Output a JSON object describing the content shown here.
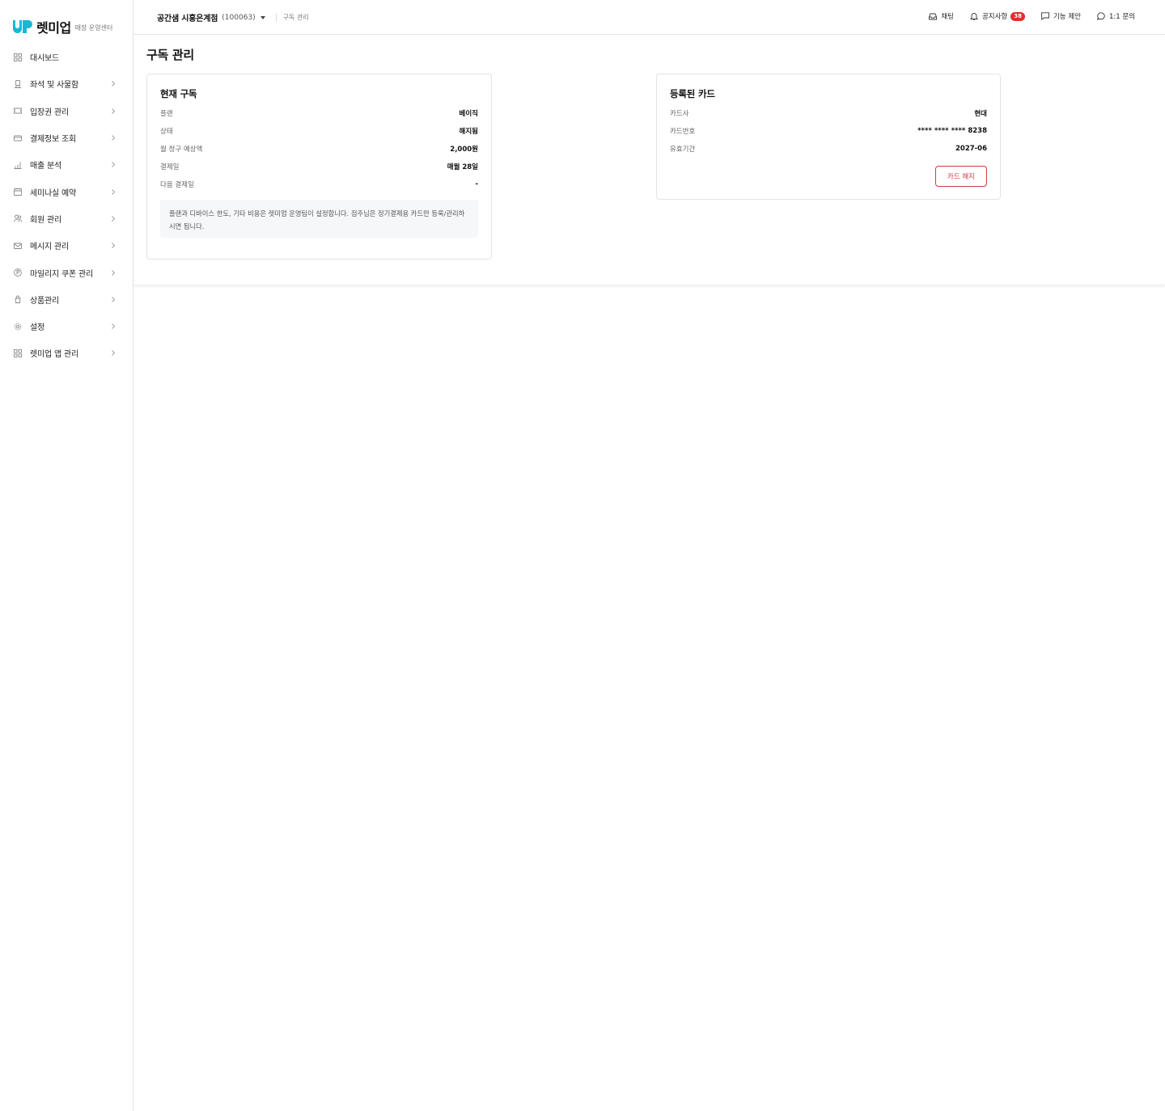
{
  "brand": {
    "name": "렛미업",
    "subtitle": "매장 운영센터",
    "accent": "#19b7d6"
  },
  "sidebar": {
    "items": [
      {
        "label": "대시보드",
        "icon": "grid-icon",
        "has_chevron": false
      },
      {
        "label": "좌석 및 사물함",
        "icon": "seat-icon",
        "has_chevron": true
      },
      {
        "label": "입장권 관리",
        "icon": "ticket-icon",
        "has_chevron": true
      },
      {
        "label": "결제정보 조회",
        "icon": "credit-card-icon",
        "has_chevron": true
      },
      {
        "label": "매출 분석",
        "icon": "bar-chart-icon",
        "has_chevron": true
      },
      {
        "label": "세미나실 예약",
        "icon": "calendar-icon",
        "has_chevron": true
      },
      {
        "label": "회원 관리",
        "icon": "users-icon",
        "has_chevron": true
      },
      {
        "label": "메시지 관리",
        "icon": "mail-icon",
        "has_chevron": true
      },
      {
        "label": "마일리지 쿠폰 관리",
        "icon": "coin-icon",
        "has_chevron": true
      },
      {
        "label": "상품관리",
        "icon": "product-icon",
        "has_chevron": true
      },
      {
        "label": "설정",
        "icon": "gear-icon",
        "has_chevron": true
      },
      {
        "label": "렛미업 앱 관리",
        "icon": "apps-icon",
        "has_chevron": true
      }
    ]
  },
  "header": {
    "store_name": "공간샘 시흥은계점",
    "store_code": "(100063)",
    "breadcrumb": "구독 관리",
    "actions": {
      "chat": "채팅",
      "notice": "공지사항",
      "notice_count": "38",
      "suggest": "기능 제안",
      "inquiry": "1:1 문의"
    }
  },
  "page": {
    "title": "구독 관리",
    "subscription": {
      "title": "현재 구독",
      "rows": [
        {
          "label": "플랜",
          "value": "베이직"
        },
        {
          "label": "상태",
          "value": "해지됨"
        },
        {
          "label": "월 청구 예상액",
          "value": "2,000원"
        },
        {
          "label": "결제일",
          "value": "매월 28일"
        },
        {
          "label": "다음 결제일",
          "value": "-"
        }
      ],
      "note": "플랜과 디바이스 한도, 기타 비용은 렛미업 운영팀이 설정합니다. 점주님은 정기결제용 카드만 등록/관리하시면 됩니다."
    },
    "card": {
      "title": "등록된 카드",
      "rows": [
        {
          "label": "카드사",
          "value": "현대"
        },
        {
          "label": "카드번호",
          "value": "**** **** **** 8238"
        },
        {
          "label": "유효기간",
          "value": "2027-06"
        }
      ],
      "cancel_label": "카드 해지",
      "cancel_color": "#d93a3a"
    }
  }
}
